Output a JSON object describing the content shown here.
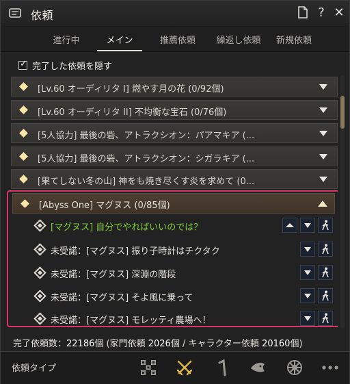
{
  "window": {
    "title": "依頼",
    "help_label": "?",
    "close_label": "✕"
  },
  "tabs": [
    {
      "label": "進行中",
      "active": false
    },
    {
      "label": "メイン",
      "active": true
    },
    {
      "label": "推薦依頼",
      "active": false
    },
    {
      "label": "繰返し依頼",
      "active": false
    },
    {
      "label": "新規依頼",
      "active": false
    }
  ],
  "filter": {
    "hide_completed_label": "完了した依頼を隠す",
    "hide_completed_checked": true
  },
  "quests": [
    {
      "title": "[Lv.60 オーディリタ I] 燃やす月の花 (0/92個)"
    },
    {
      "title": "[Lv.60 オーディリタ II] 不均衡な宝石 (0/76個)"
    },
    {
      "title": "[5人協力] 最後の砦、アトラクシオン：パアマキア (..."
    },
    {
      "title": "[5人協力] 最後の砦、アトラクシオン：シガラキア (..."
    },
    {
      "title": "[果てしない冬の山] 神をも焼き尽くす炎を求めて (0..."
    }
  ],
  "expanded_quest": {
    "title": "[Abyss One] マグヌス (0/85個)",
    "sub_quests": [
      {
        "text": "[マグヌス] 自分でやればいいのでは？",
        "highlight": true
      },
      {
        "text": "未受諾：[マグヌス] 振り子時計はチクタク",
        "highlight": false
      },
      {
        "text": "未受諾：[マグヌス] 深淵の階段",
        "highlight": false
      },
      {
        "text": "未受諾：[マグヌス] そよ風に乗って",
        "highlight": false
      },
      {
        "text": "未受諾：[マグヌス] モレッティ農場へ！",
        "highlight": false
      }
    ]
  },
  "summary": {
    "prefix": "完了依頼数：",
    "total": "22186",
    "mid1": "個 (家門依頼 ",
    "family": "2026",
    "mid2": "個 / キャラクター依頼 ",
    "character": "20160",
    "suffix": "個)"
  },
  "bottom": {
    "type_label": "依頼タイプ",
    "icons": [
      "all-quests-icon",
      "combat-icon",
      "life-icon",
      "fishing-icon",
      "trade-icon",
      "more-icon"
    ],
    "active_icon_color": "#e0b84a"
  },
  "colors": {
    "highlight_border": "#d9356a",
    "accepted_text": "#7fcf3a"
  }
}
